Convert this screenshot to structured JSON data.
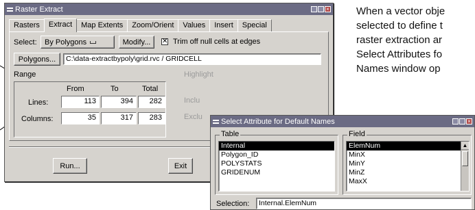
{
  "description_lines": [
    "When a vector obje",
    "selected to define t",
    "raster extraction ar",
    "Select Attributes fo",
    "Names window op"
  ],
  "raster_window": {
    "title": "Raster Extract",
    "tabs": [
      "Rasters",
      "Extract",
      "Map Extents",
      "Zoom/Orient",
      "Values",
      "Insert",
      "Special"
    ],
    "select_label": "Select:",
    "select_value": "By Polygons",
    "modify_button": "Modify...",
    "trim_checkbox_label": "Trim off null cells at edges",
    "trim_checked": true,
    "polygons_button": "Polygons...",
    "path_value": "C:\\data-extractbypoly\\grid.rvc / GRIDCELL",
    "range": {
      "label": "Range",
      "headers": [
        "From",
        "To",
        "Total"
      ],
      "rows": [
        {
          "label": "Lines:",
          "from": "113",
          "to": "394",
          "total": "282"
        },
        {
          "label": "Columns:",
          "from": "35",
          "to": "317",
          "total": "283"
        }
      ]
    },
    "highlight_label": "Highlight",
    "include_label": "Inclu",
    "exclude_label": "Exclu",
    "run_button": "Run...",
    "exit_button": "Exit"
  },
  "attr_window": {
    "title": "Select Attribute for Default Names",
    "table_group": "Table",
    "table_items": [
      "Internal",
      "Polygon_ID",
      "POLYSTATS",
      "GRIDENUM"
    ],
    "table_selected_index": 0,
    "field_group": "Field",
    "field_items": [
      "ElemNum",
      "MinX",
      "MinY",
      "MinZ",
      "MaxX"
    ],
    "field_selected_index": 0,
    "selection_label": "Selection:",
    "selection_value": "Internal.ElemNum"
  }
}
